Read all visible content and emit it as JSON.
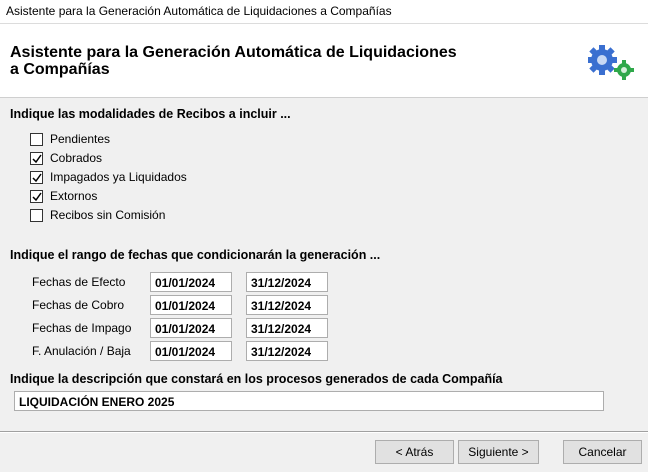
{
  "window": {
    "title": "Asistente para la Generación Automática de Liquidaciones a Compañías"
  },
  "header": {
    "title_line1": "Asistente para la Generación Automática de Liquidaciones",
    "title_line2": "a Compañías",
    "icon": "gears-icon"
  },
  "recibos": {
    "label": "Indique las modalidades de Recibos a incluir ...",
    "options": [
      {
        "label": "Pendientes",
        "checked": false
      },
      {
        "label": "Cobrados",
        "checked": true
      },
      {
        "label": "Impagados ya Liquidados",
        "checked": true
      },
      {
        "label": "Extornos",
        "checked": true
      },
      {
        "label": "Recibos sin Comisión",
        "checked": false
      }
    ]
  },
  "fechas": {
    "label": "Indique el rango de fechas que condicionarán la generación ...",
    "rows": [
      {
        "label": "Fechas de Efecto",
        "from": "01/01/2024",
        "to": "31/12/2024"
      },
      {
        "label": "Fechas de Cobro",
        "from": "01/01/2024",
        "to": "31/12/2024"
      },
      {
        "label": "Fechas de Impago",
        "from": "01/01/2024",
        "to": "31/12/2024"
      },
      {
        "label": "F. Anulación / Baja",
        "from": "01/01/2024",
        "to": "31/12/2024"
      }
    ]
  },
  "descripcion": {
    "label": "Indique la descripción que constará en los procesos generados de cada Compañía",
    "value": "LIQUIDACIÓN ENERO 2025"
  },
  "buttons": {
    "back": "< Atrás",
    "next": "Siguiente >",
    "cancel": "Cancelar"
  }
}
